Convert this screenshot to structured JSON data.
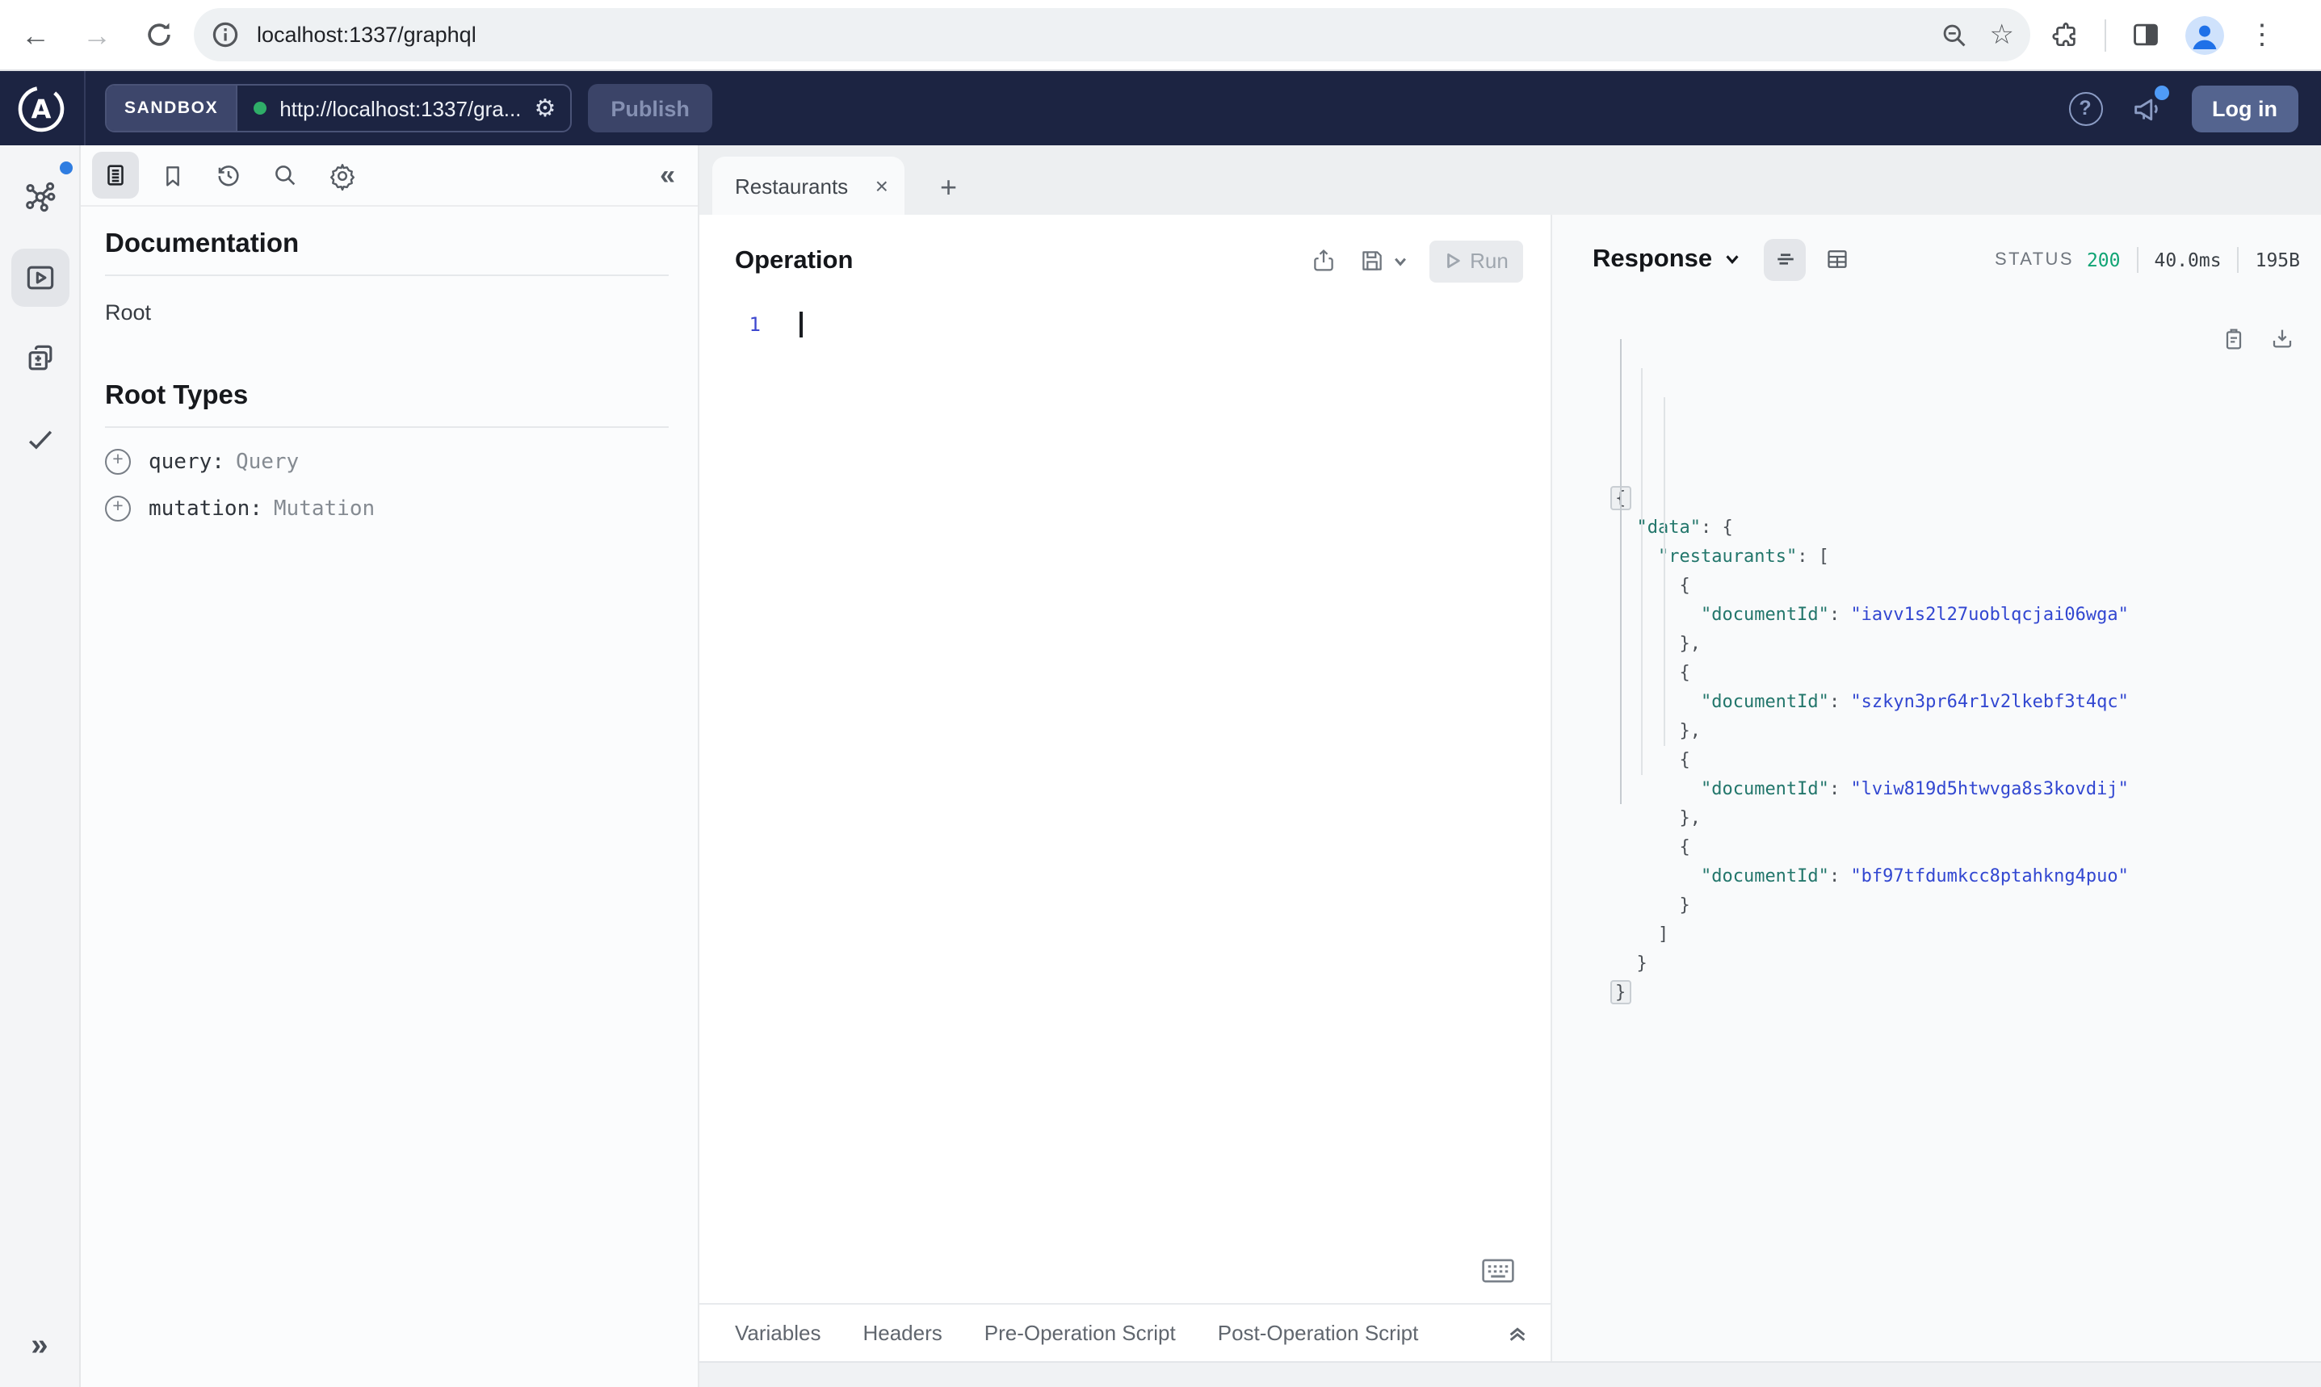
{
  "colors": {
    "header_bg": "#1c2442",
    "accent_blue": "#3d47cf",
    "json_key": "#22766b",
    "json_string": "#3247d1",
    "status_green": "#10a474",
    "connected_dot": "#2fae68",
    "login_button_bg": "#54648f"
  },
  "browser": {
    "url": "localhost:1337/graphql",
    "icons": {
      "back": "←",
      "forward": "→",
      "star": "☆",
      "more": "⋮"
    }
  },
  "apollo_header": {
    "logo_letter": "A",
    "env_badge": "SANDBOX",
    "endpoint_url": "http://localhost:1337/gra...",
    "gear_glyph": "⚙",
    "publish_button": "Publish",
    "help_glyph": "?",
    "login_button": "Log in"
  },
  "sidebar": {
    "expand_glyph": "»"
  },
  "docs_panel": {
    "collapse_glyph": "«",
    "title": "Documentation",
    "root_link": "Root",
    "section_title": "Root Types",
    "plus_glyph": "+",
    "root_types": [
      {
        "field": "query:",
        "type": "Query"
      },
      {
        "field": "mutation:",
        "type": "Mutation"
      }
    ]
  },
  "tab_bar": {
    "active_tab": "Restaurants",
    "close_glyph": "×",
    "new_tab_glyph": "+"
  },
  "operation_panel": {
    "title": "Operation",
    "run_button": "Run",
    "line_number": "1",
    "bottom_tabs": [
      "Variables",
      "Headers",
      "Pre-Operation Script",
      "Post-Operation Script"
    ]
  },
  "response_panel": {
    "title": "Response",
    "status_label": "STATUS",
    "status_code": "200",
    "duration": "40.0ms",
    "size": "195B",
    "document_ids": [
      "iavv1s2l27uoblqcjai06wga",
      "szkyn3pr64r1v2lkebf3t4qc",
      "lviw819d5htwvga8s3kovdij",
      "bf97tfdumkcc8ptahkng4puo"
    ],
    "json_lines": [
      {
        "indent": 0,
        "fold": true,
        "tokens": [
          {
            "t": "punc",
            "v": "{"
          }
        ]
      },
      {
        "indent": 1,
        "tokens": [
          {
            "t": "key",
            "v": "\"data\""
          },
          {
            "t": "punc",
            "v": ": {"
          }
        ]
      },
      {
        "indent": 2,
        "tokens": [
          {
            "t": "key",
            "v": "\"restaurants\""
          },
          {
            "t": "punc",
            "v": ": ["
          }
        ]
      },
      {
        "indent": 3,
        "tokens": [
          {
            "t": "punc",
            "v": "{"
          }
        ]
      },
      {
        "indent": 4,
        "tokens": [
          {
            "t": "key",
            "v": "\"documentId\""
          },
          {
            "t": "punc",
            "v": ": "
          },
          {
            "t": "str",
            "v": "\"iavv1s2l27uoblqcjai06wga\""
          }
        ]
      },
      {
        "indent": 3,
        "tokens": [
          {
            "t": "punc",
            "v": "},"
          }
        ]
      },
      {
        "indent": 3,
        "tokens": [
          {
            "t": "punc",
            "v": "{"
          }
        ]
      },
      {
        "indent": 4,
        "tokens": [
          {
            "t": "key",
            "v": "\"documentId\""
          },
          {
            "t": "punc",
            "v": ": "
          },
          {
            "t": "str",
            "v": "\"szkyn3pr64r1v2lkebf3t4qc\""
          }
        ]
      },
      {
        "indent": 3,
        "tokens": [
          {
            "t": "punc",
            "v": "},"
          }
        ]
      },
      {
        "indent": 3,
        "tokens": [
          {
            "t": "punc",
            "v": "{"
          }
        ]
      },
      {
        "indent": 4,
        "tokens": [
          {
            "t": "key",
            "v": "\"documentId\""
          },
          {
            "t": "punc",
            "v": ": "
          },
          {
            "t": "str",
            "v": "\"lviw819d5htwvga8s3kovdij\""
          }
        ]
      },
      {
        "indent": 3,
        "tokens": [
          {
            "t": "punc",
            "v": "},"
          }
        ]
      },
      {
        "indent": 3,
        "tokens": [
          {
            "t": "punc",
            "v": "{"
          }
        ]
      },
      {
        "indent": 4,
        "tokens": [
          {
            "t": "key",
            "v": "\"documentId\""
          },
          {
            "t": "punc",
            "v": ": "
          },
          {
            "t": "str",
            "v": "\"bf97tfdumkcc8ptahkng4puo\""
          }
        ]
      },
      {
        "indent": 3,
        "tokens": [
          {
            "t": "punc",
            "v": "}"
          }
        ]
      },
      {
        "indent": 2,
        "tokens": [
          {
            "t": "punc",
            "v": "]"
          }
        ]
      },
      {
        "indent": 1,
        "tokens": [
          {
            "t": "punc",
            "v": "}"
          }
        ]
      },
      {
        "indent": 0,
        "fold": true,
        "tokens": [
          {
            "t": "punc",
            "v": "}"
          }
        ]
      }
    ]
  }
}
